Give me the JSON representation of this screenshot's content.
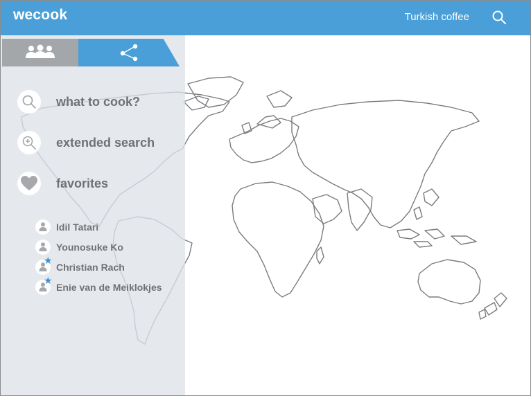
{
  "header": {
    "brand": "wecook",
    "search_query": "Turkish coffee",
    "search_icon": "search-icon",
    "background_color": "#4a9fd8"
  },
  "sidebar": {
    "tabs": [
      {
        "name": "people",
        "icon": "people-icon",
        "active": false,
        "color": "#a4a7aa"
      },
      {
        "name": "share",
        "icon": "share-icon",
        "active": true,
        "color": "#4a9fd8"
      }
    ],
    "menu": [
      {
        "label": "what to cook?",
        "icon": "search-icon"
      },
      {
        "label": "extended search",
        "icon": "zoom-in-icon"
      },
      {
        "label": "favorites",
        "icon": "heart-icon"
      }
    ],
    "friends": [
      {
        "name": "Idil Tatari",
        "starred": false
      },
      {
        "name": "Younosuke Ko",
        "starred": false
      },
      {
        "name": "Christian Rach",
        "starred": true
      },
      {
        "name": "Enie van de Meiklokjes",
        "starred": true
      }
    ]
  },
  "map": {
    "icon": "world-map"
  },
  "colors": {
    "accent": "#4a9fd8",
    "star": "#3a8fd6",
    "text": "#6f7174",
    "icon_gray": "#a6a8ab"
  }
}
